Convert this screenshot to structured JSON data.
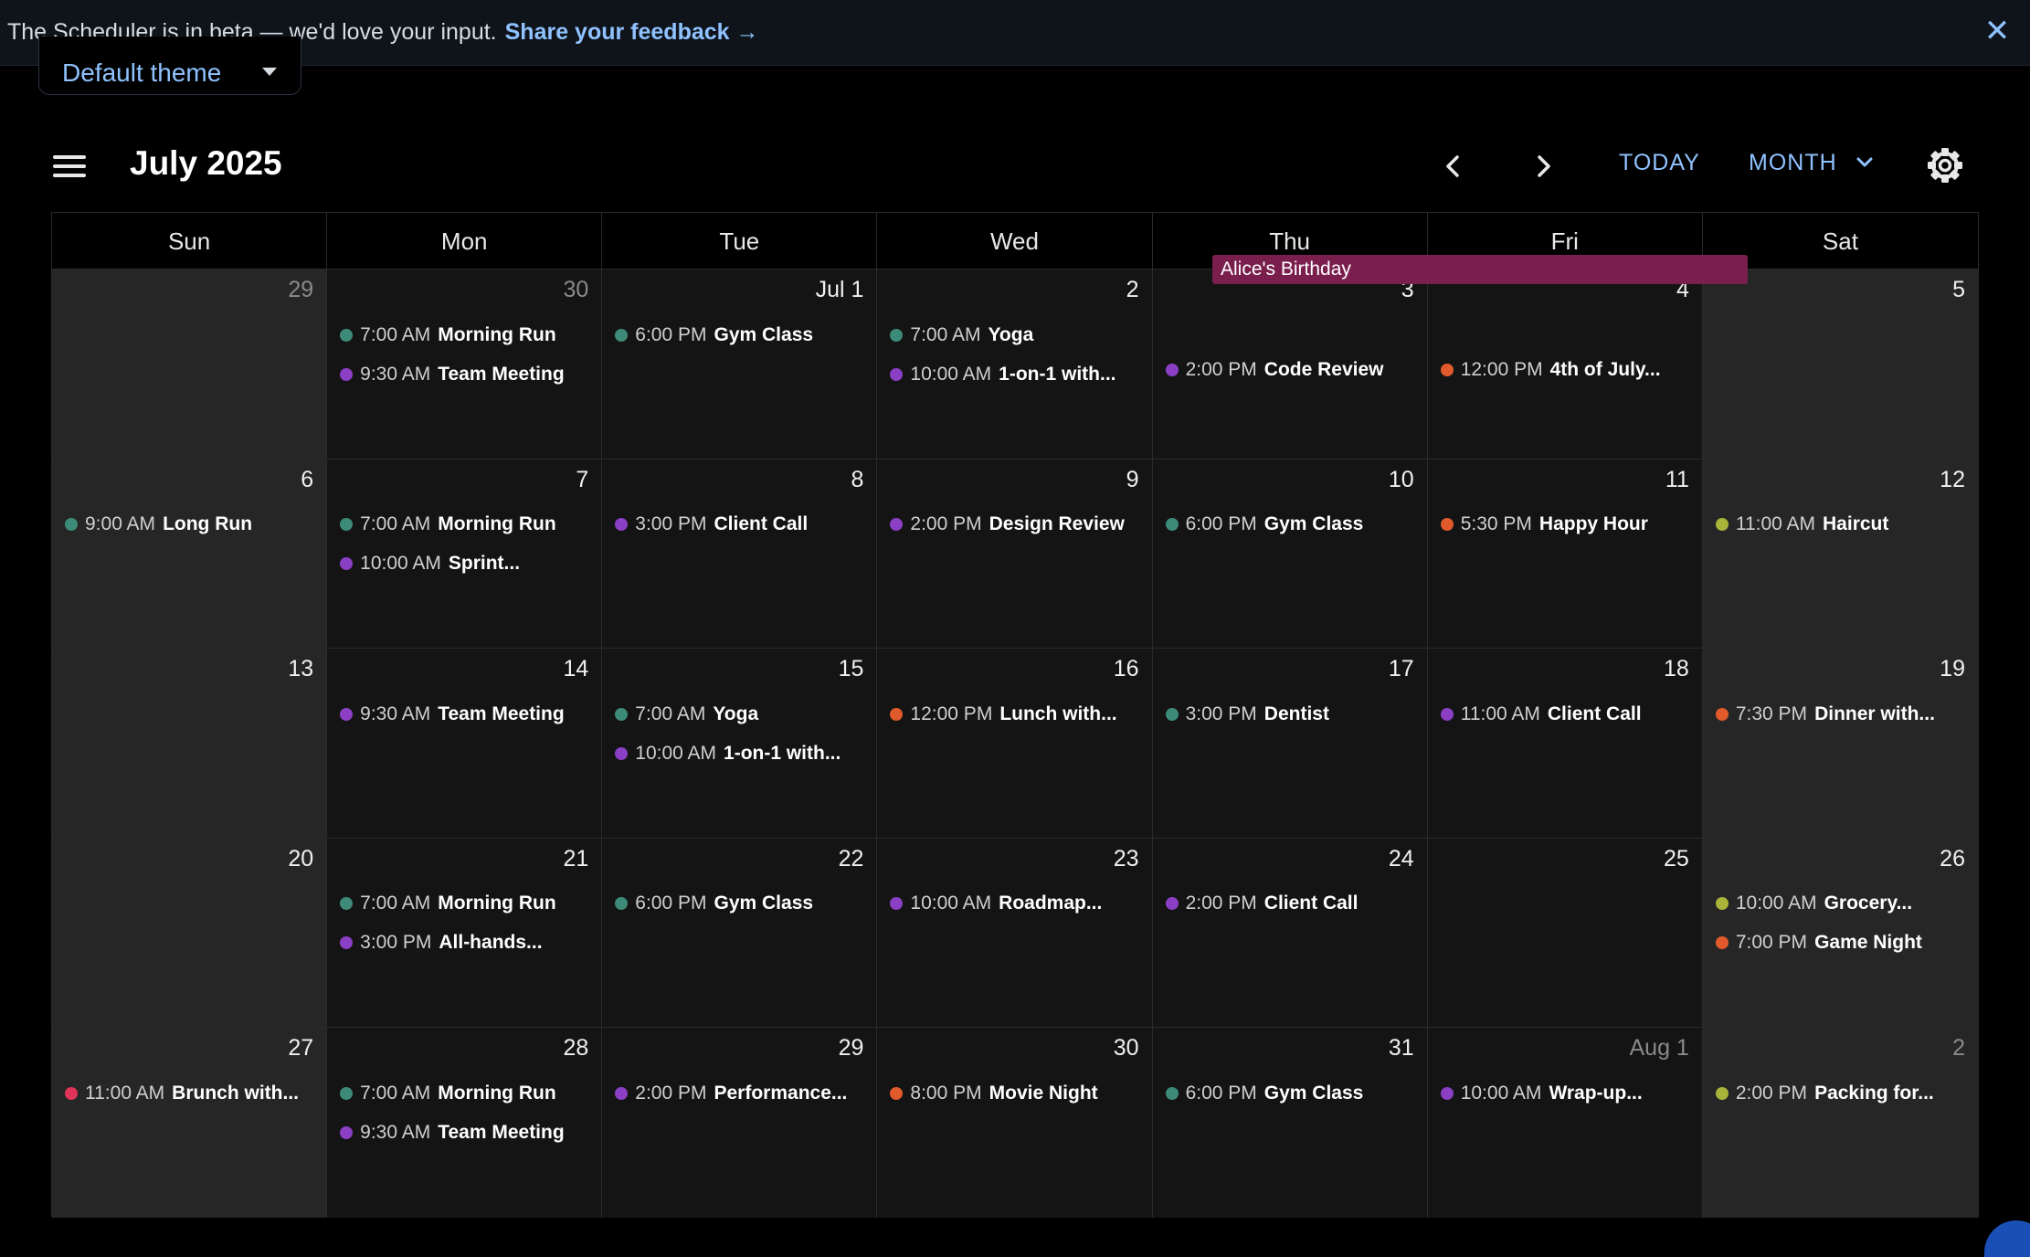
{
  "banner": {
    "message": "The Scheduler is in beta — we'd love your input.",
    "link_text": "Share your feedback →",
    "close_glyph": "✕"
  },
  "theme_select": {
    "value": "Default theme"
  },
  "toolbar": {
    "title": "July 2025",
    "today_label": "TODAY",
    "view_label": "MONTH"
  },
  "calendar": {
    "weekdays": [
      "Sun",
      "Mon",
      "Tue",
      "Wed",
      "Thu",
      "Fri",
      "Sat"
    ],
    "all_day_event": {
      "title": "Alice's Birthday",
      "color": "#7a1e4e"
    },
    "weeks": [
      [
        {
          "date": "29",
          "outside": true,
          "events": []
        },
        {
          "date": "30",
          "outside": true,
          "events": [
            {
              "time": "7:00 AM",
              "title": "Morning Run",
              "color": "#3d8a78"
            },
            {
              "time": "9:30 AM",
              "title": "Team Meeting",
              "color": "#8a3fc4"
            }
          ]
        },
        {
          "date": "Jul 1",
          "events": [
            {
              "time": "6:00 PM",
              "title": "Gym Class",
              "color": "#3d8a78"
            }
          ]
        },
        {
          "date": "2",
          "events": [
            {
              "time": "7:00 AM",
              "title": "Yoga",
              "color": "#3d8a78"
            },
            {
              "time": "10:00 AM",
              "title": "1-on-1 with...",
              "color": "#8a3fc4"
            }
          ]
        },
        {
          "date": "3",
          "allday": true,
          "events": [
            {
              "time": "2:00 PM",
              "title": "Code Review",
              "color": "#8a3fc4"
            }
          ]
        },
        {
          "date": "4",
          "allday": true,
          "events": [
            {
              "time": "12:00 PM",
              "title": "4th of July...",
              "color": "#e05a2b"
            }
          ]
        },
        {
          "date": "5",
          "events": []
        }
      ],
      [
        {
          "date": "6",
          "events": [
            {
              "time": "9:00 AM",
              "title": "Long Run",
              "color": "#3d8a78"
            }
          ]
        },
        {
          "date": "7",
          "events": [
            {
              "time": "7:00 AM",
              "title": "Morning Run",
              "color": "#3d8a78"
            },
            {
              "time": "10:00 AM",
              "title": "Sprint...",
              "color": "#8a3fc4"
            }
          ]
        },
        {
          "date": "8",
          "events": [
            {
              "time": "3:00 PM",
              "title": "Client Call",
              "color": "#8a3fc4"
            }
          ]
        },
        {
          "date": "9",
          "events": [
            {
              "time": "2:00 PM",
              "title": "Design Review",
              "color": "#8a3fc4"
            }
          ]
        },
        {
          "date": "10",
          "events": [
            {
              "time": "6:00 PM",
              "title": "Gym Class",
              "color": "#3d8a78"
            }
          ]
        },
        {
          "date": "11",
          "events": [
            {
              "time": "5:30 PM",
              "title": "Happy Hour",
              "color": "#e05a2b"
            }
          ]
        },
        {
          "date": "12",
          "events": [
            {
              "time": "11:00 AM",
              "title": "Haircut",
              "color": "#a8b33a"
            }
          ]
        }
      ],
      [
        {
          "date": "13",
          "events": []
        },
        {
          "date": "14",
          "events": [
            {
              "time": "9:30 AM",
              "title": "Team Meeting",
              "color": "#8a3fc4"
            }
          ]
        },
        {
          "date": "15",
          "events": [
            {
              "time": "7:00 AM",
              "title": "Yoga",
              "color": "#3d8a78"
            },
            {
              "time": "10:00 AM",
              "title": "1-on-1 with...",
              "color": "#8a3fc4"
            }
          ]
        },
        {
          "date": "16",
          "events": [
            {
              "time": "12:00 PM",
              "title": "Lunch with...",
              "color": "#e05a2b"
            }
          ]
        },
        {
          "date": "17",
          "events": [
            {
              "time": "3:00 PM",
              "title": "Dentist",
              "color": "#3d8a78"
            }
          ]
        },
        {
          "date": "18",
          "events": [
            {
              "time": "11:00 AM",
              "title": "Client Call",
              "color": "#8a3fc4"
            }
          ]
        },
        {
          "date": "19",
          "events": [
            {
              "time": "7:30 PM",
              "title": "Dinner with...",
              "color": "#e05a2b"
            }
          ]
        }
      ],
      [
        {
          "date": "20",
          "events": []
        },
        {
          "date": "21",
          "events": [
            {
              "time": "7:00 AM",
              "title": "Morning Run",
              "color": "#3d8a78"
            },
            {
              "time": "3:00 PM",
              "title": "All-hands...",
              "color": "#8a3fc4"
            }
          ]
        },
        {
          "date": "22",
          "events": [
            {
              "time": "6:00 PM",
              "title": "Gym Class",
              "color": "#3d8a78"
            }
          ]
        },
        {
          "date": "23",
          "events": [
            {
              "time": "10:00 AM",
              "title": "Roadmap...",
              "color": "#8a3fc4"
            }
          ]
        },
        {
          "date": "24",
          "events": [
            {
              "time": "2:00 PM",
              "title": "Client Call",
              "color": "#8a3fc4"
            }
          ]
        },
        {
          "date": "25",
          "events": []
        },
        {
          "date": "26",
          "events": [
            {
              "time": "10:00 AM",
              "title": "Grocery...",
              "color": "#a8b33a"
            },
            {
              "time": "7:00 PM",
              "title": "Game Night",
              "color": "#e05a2b"
            }
          ]
        }
      ],
      [
        {
          "date": "27",
          "events": [
            {
              "time": "11:00 AM",
              "title": "Brunch with...",
              "color": "#e0345a"
            }
          ]
        },
        {
          "date": "28",
          "events": [
            {
              "time": "7:00 AM",
              "title": "Morning Run",
              "color": "#3d8a78"
            },
            {
              "time": "9:30 AM",
              "title": "Team Meeting",
              "color": "#8a3fc4"
            }
          ]
        },
        {
          "date": "29",
          "events": [
            {
              "time": "2:00 PM",
              "title": "Performance...",
              "color": "#8a3fc4"
            }
          ]
        },
        {
          "date": "30",
          "events": [
            {
              "time": "8:00 PM",
              "title": "Movie Night",
              "color": "#e05a2b"
            }
          ]
        },
        {
          "date": "31",
          "events": [
            {
              "time": "6:00 PM",
              "title": "Gym Class",
              "color": "#3d8a78"
            }
          ]
        },
        {
          "date": "Aug 1",
          "outside": true,
          "events": [
            {
              "time": "10:00 AM",
              "title": "Wrap-up...",
              "color": "#8a3fc4"
            }
          ]
        },
        {
          "date": "2",
          "outside": true,
          "events": [
            {
              "time": "2:00 PM",
              "title": "Packing for...",
              "color": "#a8b33a"
            }
          ]
        }
      ]
    ]
  },
  "colors": {
    "accent": "#8fc2ff",
    "background": "#000000",
    "cell": "#141414",
    "weekend_cell": "#262626"
  }
}
